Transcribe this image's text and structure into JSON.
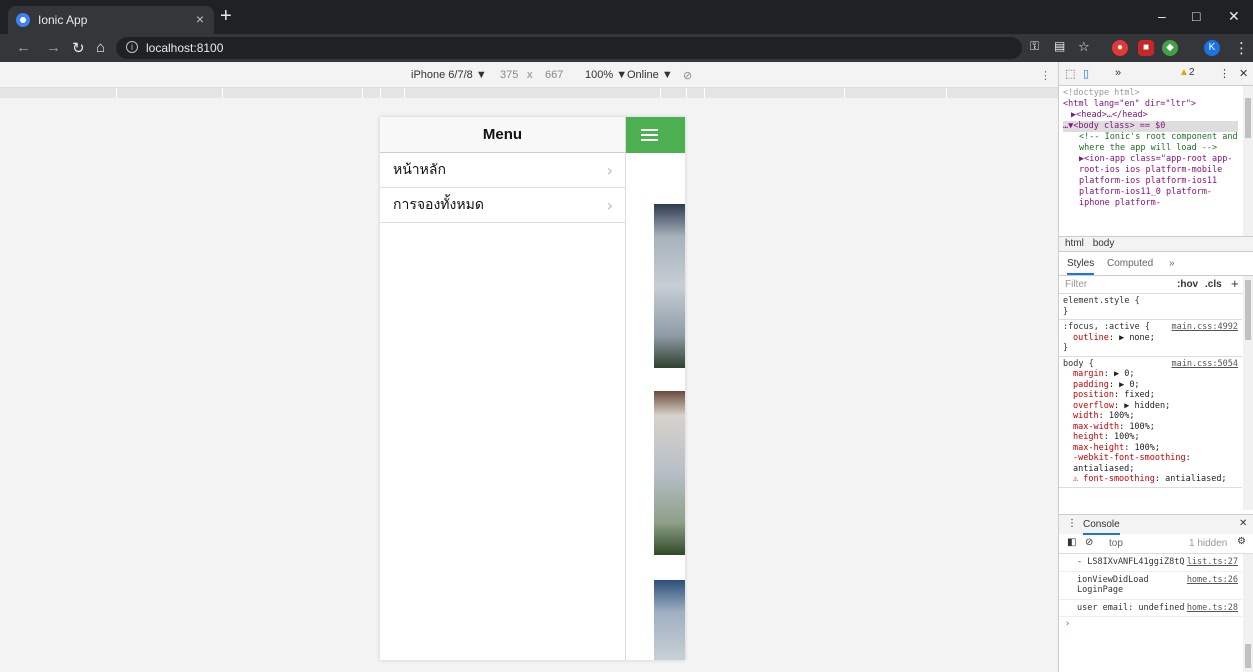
{
  "browser": {
    "tab_title": "Ionic App",
    "tab_close": "×",
    "new_tab": "+",
    "url": "localhost:8100",
    "win_min": "–",
    "win_max": "□",
    "win_close": "✕",
    "accent": "#3b82f6"
  },
  "device_toolbar": {
    "device": "iPhone 6/7/8 ▼",
    "width": "375",
    "times": "x",
    "height": "667",
    "zoom": "100% ▼",
    "network": "Online ▼"
  },
  "app": {
    "menu_title": "Menu",
    "menu_items": [
      {
        "label": "หน้าหลัก"
      },
      {
        "label": "การจองทั้งหมด"
      }
    ],
    "header_color": "#4caf50"
  },
  "devtools": {
    "tab_more": "»",
    "warning_count": "2",
    "elements": [
      "<!doctype html>",
      "<html lang=\"en\" dir=\"ltr\">",
      "▶<head>…</head>",
      "…▼<body class> == $0",
      "<!-- Ionic's root component and where the app will load -->",
      "▶<ion-app class=\"app-root app-root-ios ios platform-mobile platform-ios platform-ios11 platform-ios11_0 platform-iphone platform-"
    ],
    "crumbs": [
      "html",
      "body"
    ],
    "style_tabs": [
      "Styles",
      "Computed",
      "»"
    ],
    "filter_placeholder": "Filter",
    "filter_hov": ":hov",
    "filter_cls": ".cls",
    "filter_plus": "+",
    "rules": [
      {
        "selector": "element.style {",
        "source": "",
        "props": [],
        "close": "}"
      },
      {
        "selector": ":focus, :active {",
        "source": "main.css:4992",
        "props": [
          {
            "name": "outline",
            "value": "▶ none;"
          }
        ],
        "close": "}"
      },
      {
        "selector": "body {",
        "source": "main.css:5054",
        "props": [
          {
            "name": "margin",
            "value": "▶ 0;"
          },
          {
            "name": "padding",
            "value": "▶ 0;"
          },
          {
            "name": "position",
            "value": "fixed;"
          },
          {
            "name": "overflow",
            "value": "▶ hidden;"
          },
          {
            "name": "width",
            "value": "100%;"
          },
          {
            "name": "max-width",
            "value": "100%;"
          },
          {
            "name": "height",
            "value": "100%;"
          },
          {
            "name": "max-height",
            "value": "100%;"
          },
          {
            "name": "-webkit-font-smoothing",
            "value": "antialiased;"
          },
          {
            "name": "⚠ font-smoothing",
            "value": "antialiased;"
          }
        ],
        "close": ""
      }
    ],
    "console_title": "Console",
    "console_context": "top",
    "console_hidden": "1 hidden",
    "messages": [
      {
        "text": "- LS8IXvANFL41ggiZ8tQ",
        "source": "list.ts:27"
      },
      {
        "text": "ionViewDidLoad LoginPage",
        "source": "home.ts:26"
      },
      {
        "text": "user email: undefined",
        "source": "home.ts:28"
      }
    ],
    "prompt": "›"
  }
}
